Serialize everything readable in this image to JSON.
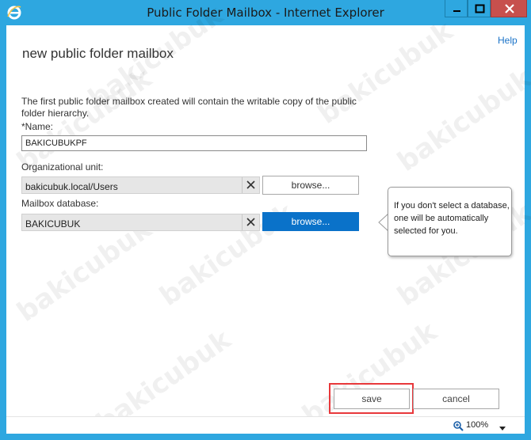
{
  "window": {
    "title": "Public Folder Mailbox - Internet Explorer",
    "colors": {
      "titlebar": "#2ea7e0",
      "close_button": "#c7504d",
      "accent": "#0a72c9",
      "highlight": "#e8383b"
    }
  },
  "header": {
    "help_label": "Help"
  },
  "page": {
    "title": "new public folder mailbox",
    "description": "The first public folder mailbox created will contain the writable copy of the public folder hierarchy."
  },
  "form": {
    "name_label": "*Name:",
    "name_value": "BAKICUBUKPF",
    "ou_label": "Organizational unit:",
    "ou_value": "bakicubuk.local/Users",
    "ou_browse_label": "browse...",
    "db_label": "Mailbox database:",
    "db_value": "BAKICUBUK",
    "db_browse_label": "browse..."
  },
  "callout": {
    "text": "If you don't select a database, one will be automatically selected for you."
  },
  "footer": {
    "save_label": "save",
    "cancel_label": "cancel"
  },
  "status": {
    "zoom": "100%"
  },
  "watermark": "bakicubuk",
  "icons": [
    "ie-logo-icon",
    "minimize-icon",
    "maximize-icon",
    "close-icon",
    "clear-icon",
    "zoom-icon",
    "caret-down-icon"
  ]
}
